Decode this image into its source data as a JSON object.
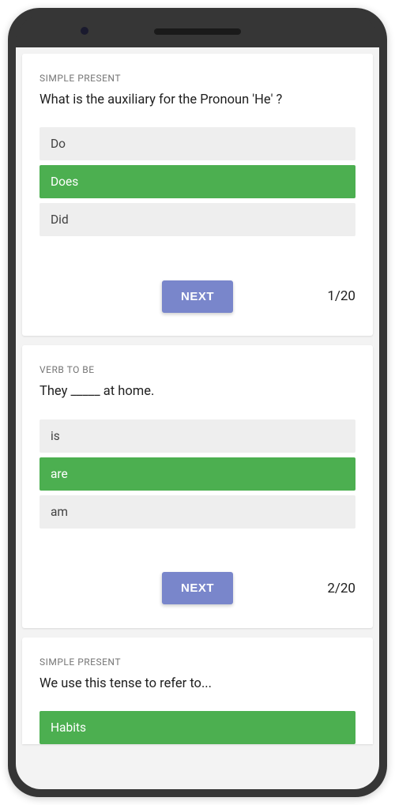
{
  "cards": [
    {
      "category": "SIMPLE PRESENT",
      "question": "What is the auxiliary for the Pronoun 'He' ?",
      "options": [
        {
          "label": "Do",
          "selected": false
        },
        {
          "label": "Does",
          "selected": true
        },
        {
          "label": "Did",
          "selected": false
        }
      ],
      "next_label": "NEXT",
      "counter": "1/20"
    },
    {
      "category": "VERB TO BE",
      "question": "They _____ at home.",
      "options": [
        {
          "label": "is",
          "selected": false
        },
        {
          "label": "are",
          "selected": true
        },
        {
          "label": "am",
          "selected": false
        }
      ],
      "next_label": "NEXT",
      "counter": "2/20"
    },
    {
      "category": "SIMPLE PRESENT",
      "question": "We use this tense to refer to...",
      "options": [
        {
          "label": "Habits",
          "selected": true
        }
      ]
    }
  ]
}
